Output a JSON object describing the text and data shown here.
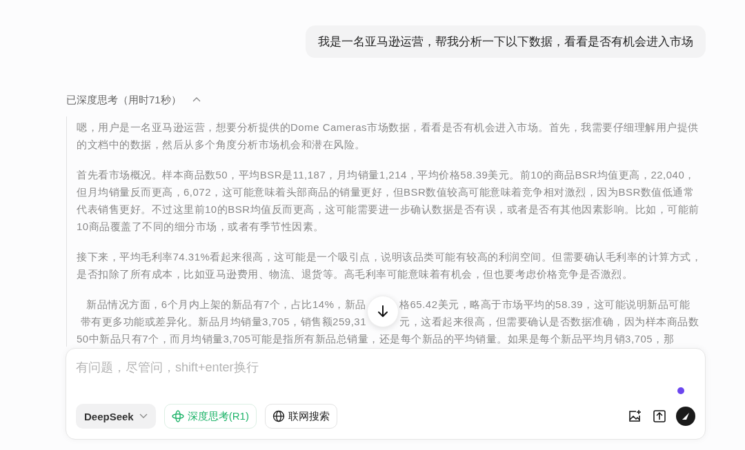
{
  "user_message": "我是一名亚马逊运营，帮我分析一下以下数据，看看是否有机会进入市场",
  "thinking": {
    "label": "已深度思考（用时71秒）",
    "expanded": true,
    "paragraphs": [
      "嗯，用户是一名亚马逊运营，想要分析提供的Dome Cameras市场数据，看看是否有机会进入市场。首先，我需要仔细理解用户提供的文档中的数据，然后从多个角度分析市场机会和潜在风险。",
      "首先看市场概况。样本商品数50，平均BSR是11,187，月均销量1,214，平均价格58.39美元。前10的商品BSR均值更高，22,040，但月均销量反而更高，6,072，这可能意味着头部商品的销量更好，但BSR数值较高可能意味着竞争相对激烈，因为BSR数值低通常代表销售更好。不过这里前10的BSR均值反而更高，这可能需要进一步确认数据是否有误，或者是否有其他因素影响。比如，可能前10商品覆盖了不同的细分市场，或者有季节性因素。",
      "接下来，平均毛利率74.31%看起来很高，这可能是一个吸引点，说明该品类可能有较高的利润空间。但需要确认毛利率的计算方式，是否扣除了所有成本，比如亚马逊费用、物流、退货等。高毛利率可能意味着有机会，但也要考虑价格竞争是否激烈。",
      {
        "lines": [
          [
            "新品情况方面，6个月内上架的新品有7个，占比14%，新品",
            "格65.42美元，略高于市场平均的58.39，这可能说明新品可能"
          ],
          [
            "带有更多功能或差异化。新品月均销量3,705，销售额259,31",
            "元，这看起来很高，但需要确认是否数据准确，因为样本商品数"
          ],
          [
            "50中新品只有7个，而月均销量3,705可能是指所有新品总销量，还是每个新品的平均销量。如果是每个新品平均月销3,705，那"
          ]
        ]
      }
    ]
  },
  "composer": {
    "placeholder": "有问题，尽管问，shift+enter换行",
    "model": "DeepSeek",
    "toggles": [
      {
        "kind": "think",
        "label": "深度思考(R1)",
        "selected": true
      },
      {
        "kind": "web",
        "label": "联网搜索",
        "selected": false
      }
    ]
  }
}
